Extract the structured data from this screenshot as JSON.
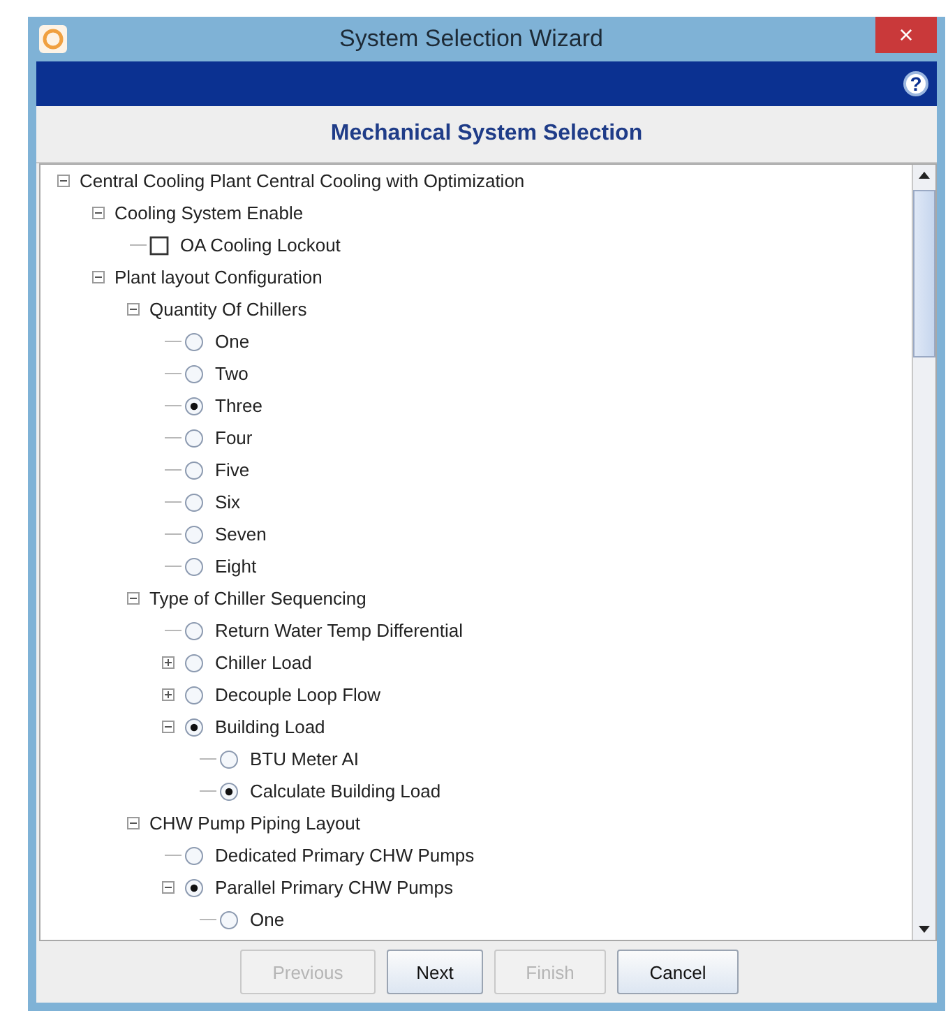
{
  "window": {
    "title": "System Selection Wizard",
    "close": "×",
    "help": "?"
  },
  "header": {
    "title": "Mechanical System Selection"
  },
  "tree": [
    {
      "kind": "group",
      "label": "Central Cooling Plant Central Cooling with Optimization",
      "expanded": true,
      "children": [
        {
          "kind": "group",
          "label": "Cooling System Enable",
          "expanded": true,
          "children": [
            {
              "kind": "checkbox",
              "label": "OA Cooling Lockout",
              "checked": false
            }
          ]
        },
        {
          "kind": "group",
          "label": "Plant layout Configuration",
          "expanded": true,
          "children": [
            {
              "kind": "group",
              "label": "Quantity Of Chillers",
              "expanded": true,
              "children": [
                {
                  "kind": "radio",
                  "label": "One",
                  "selected": false
                },
                {
                  "kind": "radio",
                  "label": "Two",
                  "selected": false
                },
                {
                  "kind": "radio",
                  "label": "Three",
                  "selected": true
                },
                {
                  "kind": "radio",
                  "label": "Four",
                  "selected": false
                },
                {
                  "kind": "radio",
                  "label": "Five",
                  "selected": false
                },
                {
                  "kind": "radio",
                  "label": "Six",
                  "selected": false
                },
                {
                  "kind": "radio",
                  "label": "Seven",
                  "selected": false
                },
                {
                  "kind": "radio",
                  "label": "Eight",
                  "selected": false
                }
              ]
            },
            {
              "kind": "group",
              "label": "Type of Chiller Sequencing",
              "expanded": true,
              "children": [
                {
                  "kind": "radio",
                  "label": "Return Water Temp Differential",
                  "selected": false
                },
                {
                  "kind": "radio",
                  "label": "Chiller Load",
                  "selected": false,
                  "expanded": false
                },
                {
                  "kind": "radio",
                  "label": "Decouple Loop Flow",
                  "selected": false,
                  "expanded": false
                },
                {
                  "kind": "radio",
                  "label": "Building Load",
                  "selected": true,
                  "expanded": true,
                  "children": [
                    {
                      "kind": "radio",
                      "label": "BTU Meter AI",
                      "selected": false
                    },
                    {
                      "kind": "radio",
                      "label": "Calculate Building Load",
                      "selected": true
                    }
                  ]
                }
              ]
            },
            {
              "kind": "group",
              "label": "CHW Pump Piping Layout",
              "expanded": true,
              "children": [
                {
                  "kind": "radio",
                  "label": "Dedicated Primary CHW Pumps",
                  "selected": false
                },
                {
                  "kind": "radio",
                  "label": "Parallel Primary CHW Pumps",
                  "selected": true,
                  "expanded": true,
                  "children": [
                    {
                      "kind": "radio",
                      "label": "One",
                      "selected": false
                    }
                  ]
                }
              ]
            }
          ]
        }
      ]
    }
  ],
  "buttons": [
    {
      "label": "Previous",
      "disabled": true
    },
    {
      "label": "Next",
      "disabled": false
    },
    {
      "label": "Finish",
      "disabled": true
    },
    {
      "label": "Cancel",
      "disabled": false
    }
  ]
}
